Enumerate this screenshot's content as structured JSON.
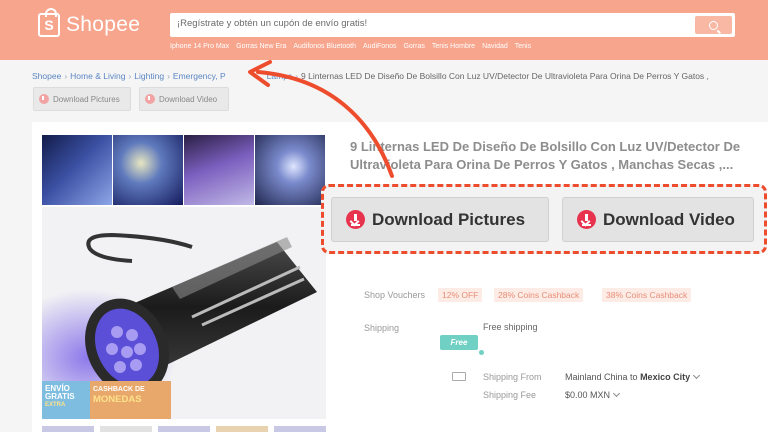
{
  "header": {
    "logo": "Shopee",
    "search_placeholder": "¡Regístrate y obtén un cupón de envío gratis!",
    "suggestions": [
      "Iphone 14 Pro Max",
      "Gorras New Era",
      "Audifonos Bluetooth",
      "AudiFonos",
      "Gorras",
      "Tenis Hombre",
      "Navidad",
      "Tenis"
    ]
  },
  "breadcrumb": [
    "Shopee",
    "Home & Living",
    "Lighting",
    "Emergency, P",
    "Lamps",
    "9 Linternas LED De Diseño De Bolsillo Con Luz UV/Detector De Ultravioleta Para Orina De Perros Y Gatos ,"
  ],
  "download_small": {
    "pictures": "Download Pictures",
    "video": "Download Video"
  },
  "download_big": {
    "pictures": "Download Pictures",
    "video": "Download Video"
  },
  "product": {
    "title": "9 Linternas LED De Diseño De Bolsillo Con Luz UV/Detector De Ultravioleta Para Orina De Perros Y Gatos , Manchas Secas ,...",
    "vouchers_label": "Shop Vouchers",
    "vouchers": [
      "12% OFF",
      "28% Coins Cashback",
      "38% Coins Cashback"
    ],
    "shipping_label": "Shipping",
    "shipping_value": "Free shipping",
    "free_badge": "Free",
    "shipping_from_label": "Shipping From",
    "shipping_from_value": "Mainland China to",
    "shipping_to": "Mexico City",
    "shipping_fee_label": "Shipping Fee",
    "shipping_fee_value": "$0.00 MXN"
  },
  "promo": {
    "left_line1": "ENVÍO",
    "left_line2": "GRATIS",
    "left_line3": "EXTRA",
    "right_line1": "CASHBACK DE",
    "right_line2": "MONEDAS"
  },
  "colors": {
    "brand": "#ee4d2d",
    "download_icon": "#e8334f",
    "header": "#f7a58d"
  }
}
